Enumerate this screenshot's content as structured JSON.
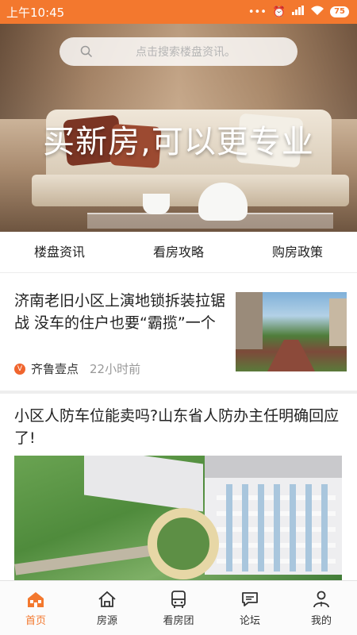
{
  "status_bar": {
    "time": "上午10:45",
    "battery": "75"
  },
  "search": {
    "placeholder": "点击搜索楼盘资讯。"
  },
  "banner": {
    "slogan": "买新房,可以更专业"
  },
  "tabs": [
    {
      "label": "楼盘资讯"
    },
    {
      "label": "看房攻略"
    },
    {
      "label": "购房政策"
    }
  ],
  "articles": [
    {
      "title": "济南老旧小区上演地锁拆装拉锯战 没车的住户也要“霸揽”一个",
      "source_badge": "V",
      "source": "齐鲁壹点",
      "time": "22小时前"
    },
    {
      "title": "小区人防车位能卖吗?山东省人防办主任明确回应了!"
    }
  ],
  "bottom_nav": [
    {
      "label": "首页",
      "icon": "home-icon",
      "active": true
    },
    {
      "label": "房源",
      "icon": "house-icon",
      "active": false
    },
    {
      "label": "看房团",
      "icon": "bus-icon",
      "active": false
    },
    {
      "label": "论坛",
      "icon": "forum-icon",
      "active": false
    },
    {
      "label": "我的",
      "icon": "user-icon",
      "active": false
    }
  ],
  "colors": {
    "accent": "#f3782e"
  }
}
